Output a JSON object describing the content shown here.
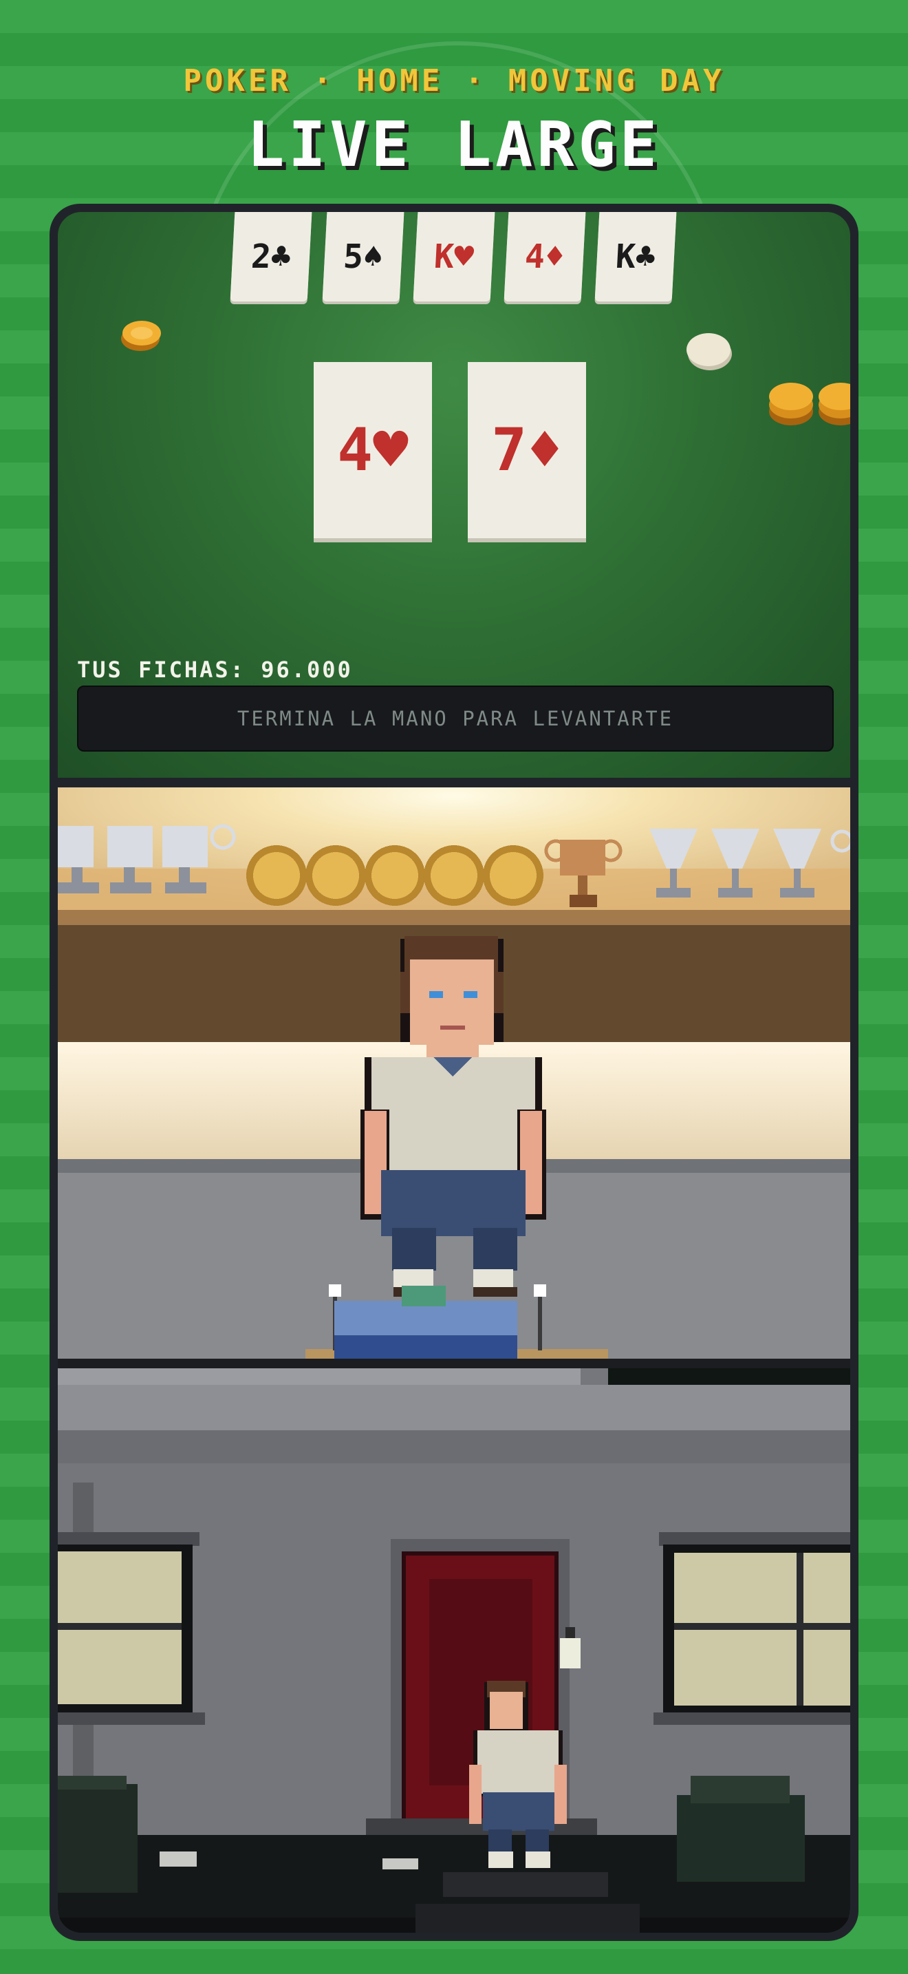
{
  "header": {
    "subtitle": "POKER · HOME · MOVING DAY",
    "title": "LIVE LARGE"
  },
  "poker": {
    "community_cards": [
      {
        "label": "2♣",
        "color": "#1b1b1b"
      },
      {
        "label": "5♠",
        "color": "#1b1b1b"
      },
      {
        "label": "K♥",
        "color": "#c0302c"
      },
      {
        "label": "4♦",
        "color": "#c0302c"
      },
      {
        "label": "K♣",
        "color": "#1b1b1b"
      }
    ],
    "hole_cards": [
      {
        "label": "4♥",
        "color": "#c0302c"
      },
      {
        "label": "7♦",
        "color": "#c0302c"
      }
    ],
    "chips_label": "TUS FICHAS: 96.000",
    "action_button": "TERMINA LA MANO PARA LEVANTARTE"
  },
  "colors": {
    "accent_yellow": "#f2c63a",
    "felt_green": "#2e6e34",
    "door_red": "#6a0f18",
    "background_green": "#3aa54a"
  },
  "scenes": {
    "home": {
      "player_icon": "player-character-icon"
    },
    "street": {
      "player_icon": "player-character-small-icon"
    }
  }
}
